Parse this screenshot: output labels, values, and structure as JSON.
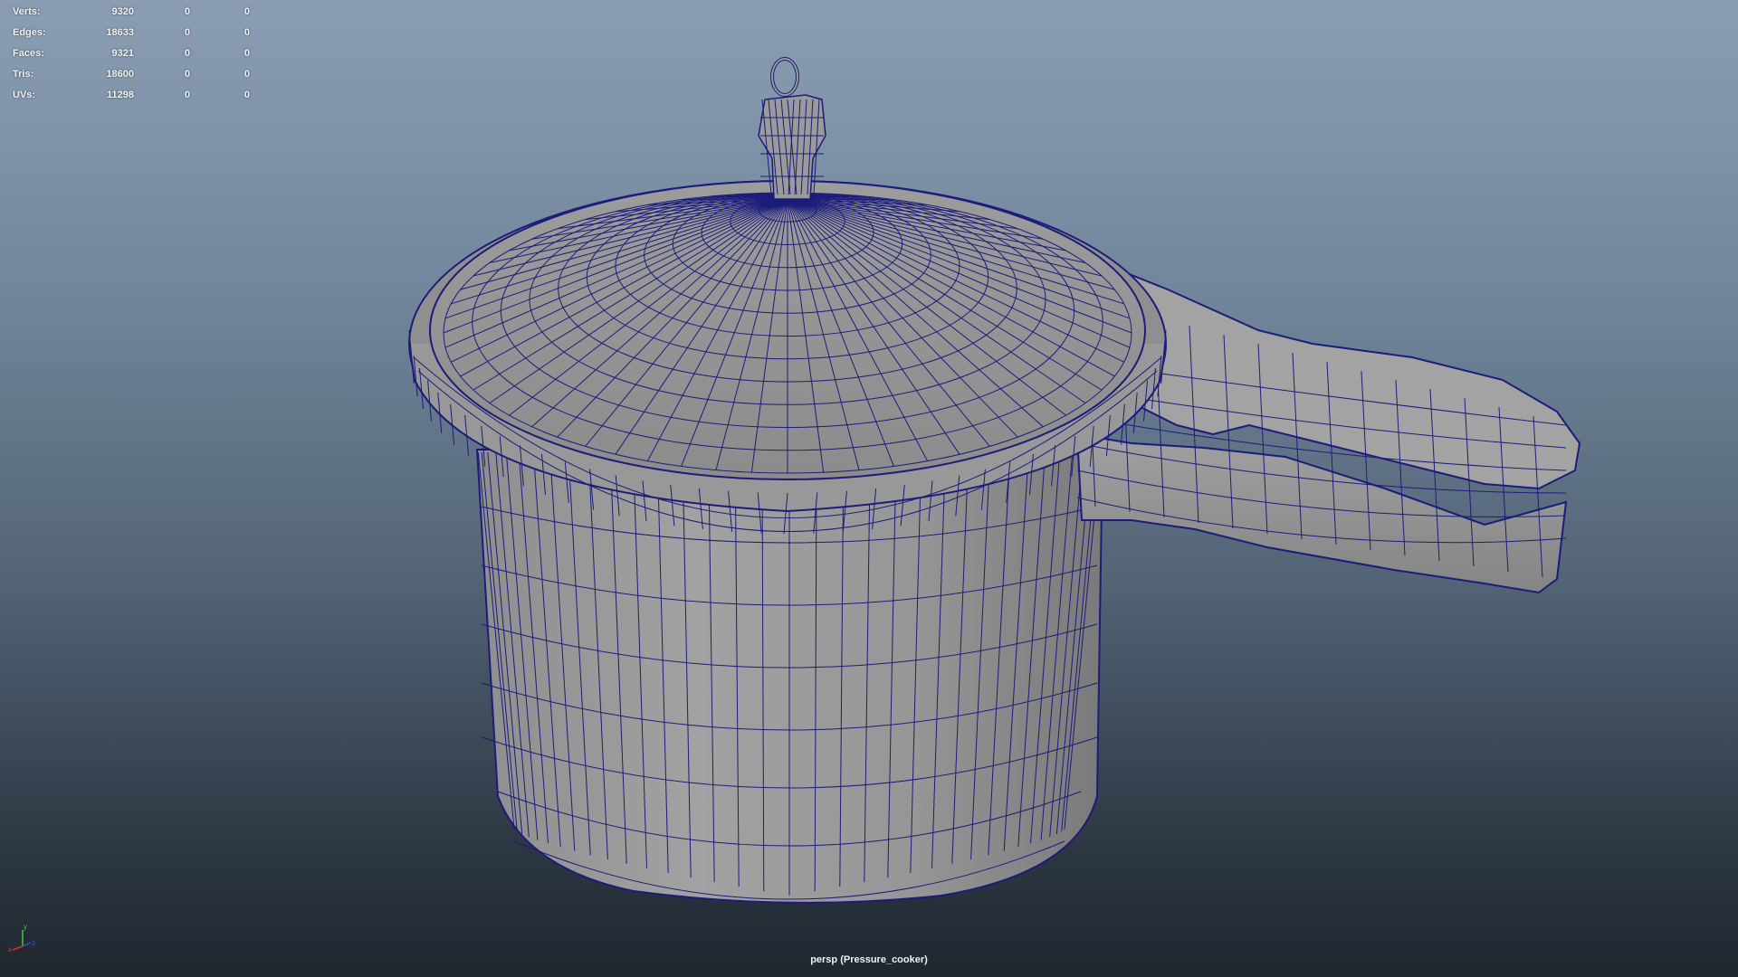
{
  "hud": {
    "rows": [
      {
        "label": "Verts:",
        "value": "9320",
        "c1": "0",
        "c2": "0"
      },
      {
        "label": "Edges:",
        "value": "18633",
        "c1": "0",
        "c2": "0"
      },
      {
        "label": "Faces:",
        "value": "9321",
        "c1": "0",
        "c2": "0"
      },
      {
        "label": "Tris:",
        "value": "18600",
        "c1": "0",
        "c2": "0"
      },
      {
        "label": "UVs:",
        "value": "11298",
        "c1": "0",
        "c2": "0"
      }
    ]
  },
  "camera_label": "persp (Pressure_cooker)",
  "axis_gizmo": {
    "x": "x",
    "y": "y",
    "z": "z"
  },
  "colors": {
    "wire": "#1c1c7a",
    "shade": "#9a9a9a",
    "bg_top": "#8a9db3",
    "bg_bottom": "#1f262e"
  },
  "icons": [
    "axis-gizmo-icon"
  ]
}
